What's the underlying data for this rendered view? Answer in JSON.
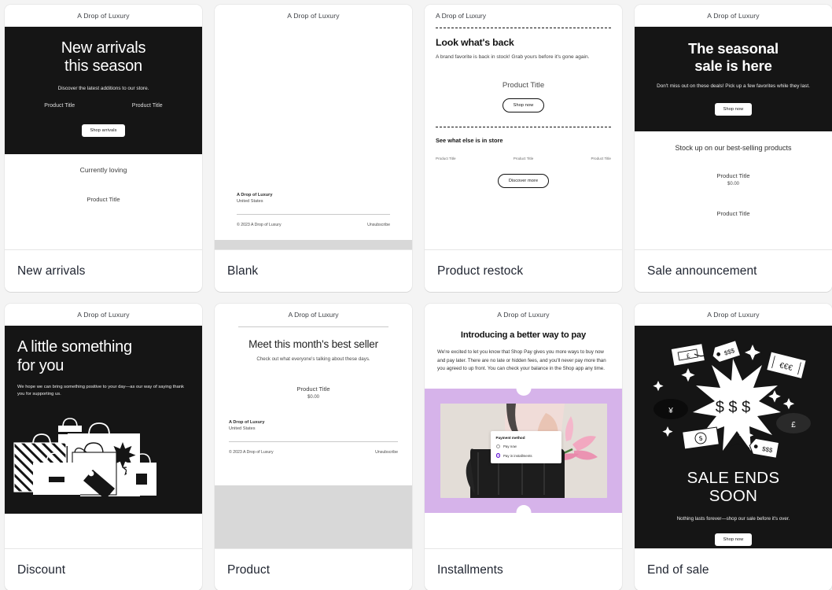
{
  "brand": "A Drop of Luxury",
  "colors": {
    "page_bg": "#f4f4f4",
    "dark": "#151515",
    "purple": "#d6b3ea",
    "radio_accent": "#5d0fd4",
    "label_text": "#1f2430"
  },
  "templates": [
    {
      "label": "New arrivals",
      "brand": "A Drop of Luxury",
      "hero_title_line1": "New arrivals",
      "hero_title_line2": "this season",
      "hero_sub": "Discover the latest additions to our store.",
      "product_left": "Product Title",
      "product_right": "Product Title",
      "cta": "Shop arrivals",
      "lower_heading": "Currently loving",
      "lower_product": "Product Title"
    },
    {
      "label": "Blank",
      "brand": "A Drop of Luxury",
      "footer_brand": "A Drop of Luxury",
      "footer_country": "United States",
      "footer_copyright": "© 2023 A Drop of Luxury",
      "footer_unsubscribe": "Unsubscribe"
    },
    {
      "label": "Product restock",
      "brand": "A Drop of Luxury",
      "heading": "Look what's back",
      "body": "A brand favorite is back in stock! Grab yours before it's gone again.",
      "product_title": "Product Title",
      "cta_primary": "Shop now",
      "subheading": "See what else is in store",
      "products": [
        "Product Title",
        "Product Title",
        "Product Title"
      ],
      "cta_secondary": "Discover more"
    },
    {
      "label": "Sale announcement",
      "brand": "A Drop of Luxury",
      "hero_title_line1": "The seasonal",
      "hero_title_line2": "sale is here",
      "hero_sub": "Don't miss out on these deals! Pick up a few favorites while they last.",
      "cta": "Shop now",
      "lower_heading": "Stock up on our best-selling products",
      "product_title": "Product Title",
      "product_price": "$0.00",
      "product_title_2": "Product Title"
    },
    {
      "label": "Discount",
      "brand": "A Drop of Luxury",
      "hero_title_line1": "A little something",
      "hero_title_line2": "for you",
      "hero_sub": "We hope we can bring something positive to your day—as our way of saying thank you for supporting us.",
      "illustration": "shopping-bags-illustration"
    },
    {
      "label": "Product",
      "brand": "A Drop of Luxury",
      "heading": "Meet this month's best seller",
      "body": "Check out what everyone's talking about these days.",
      "product_title": "Product Title",
      "product_price": "$0.00",
      "footer_brand": "A Drop of Luxury",
      "footer_country": "United States",
      "footer_copyright": "© 2023 A Drop of Luxury",
      "footer_unsubscribe": "Unsubscribe"
    },
    {
      "label": "Installments",
      "brand": "A Drop of Luxury",
      "heading": "Introducing a better way to pay",
      "body": "We're excited to let you know that Shop Pay gives you more ways to buy now and pay later. There are no late or hidden fees, and you'll never pay more than you agreed to up front. You can check your balance in the Shop app any time.",
      "payment_card_title": "Payment method",
      "payment_option_1": "Pay now",
      "payment_option_2": "Pay in installments",
      "illustration": "shop-pay-photo"
    },
    {
      "label": "End of sale",
      "brand": "A Drop of Luxury",
      "hero_title_line1": "SALE ENDS",
      "hero_title_line2": "SOON",
      "hero_sub": "Nothing lasts forever—shop our sale before it's over.",
      "cta": "Shop now",
      "illustration": "money-burst-illustration"
    }
  ]
}
